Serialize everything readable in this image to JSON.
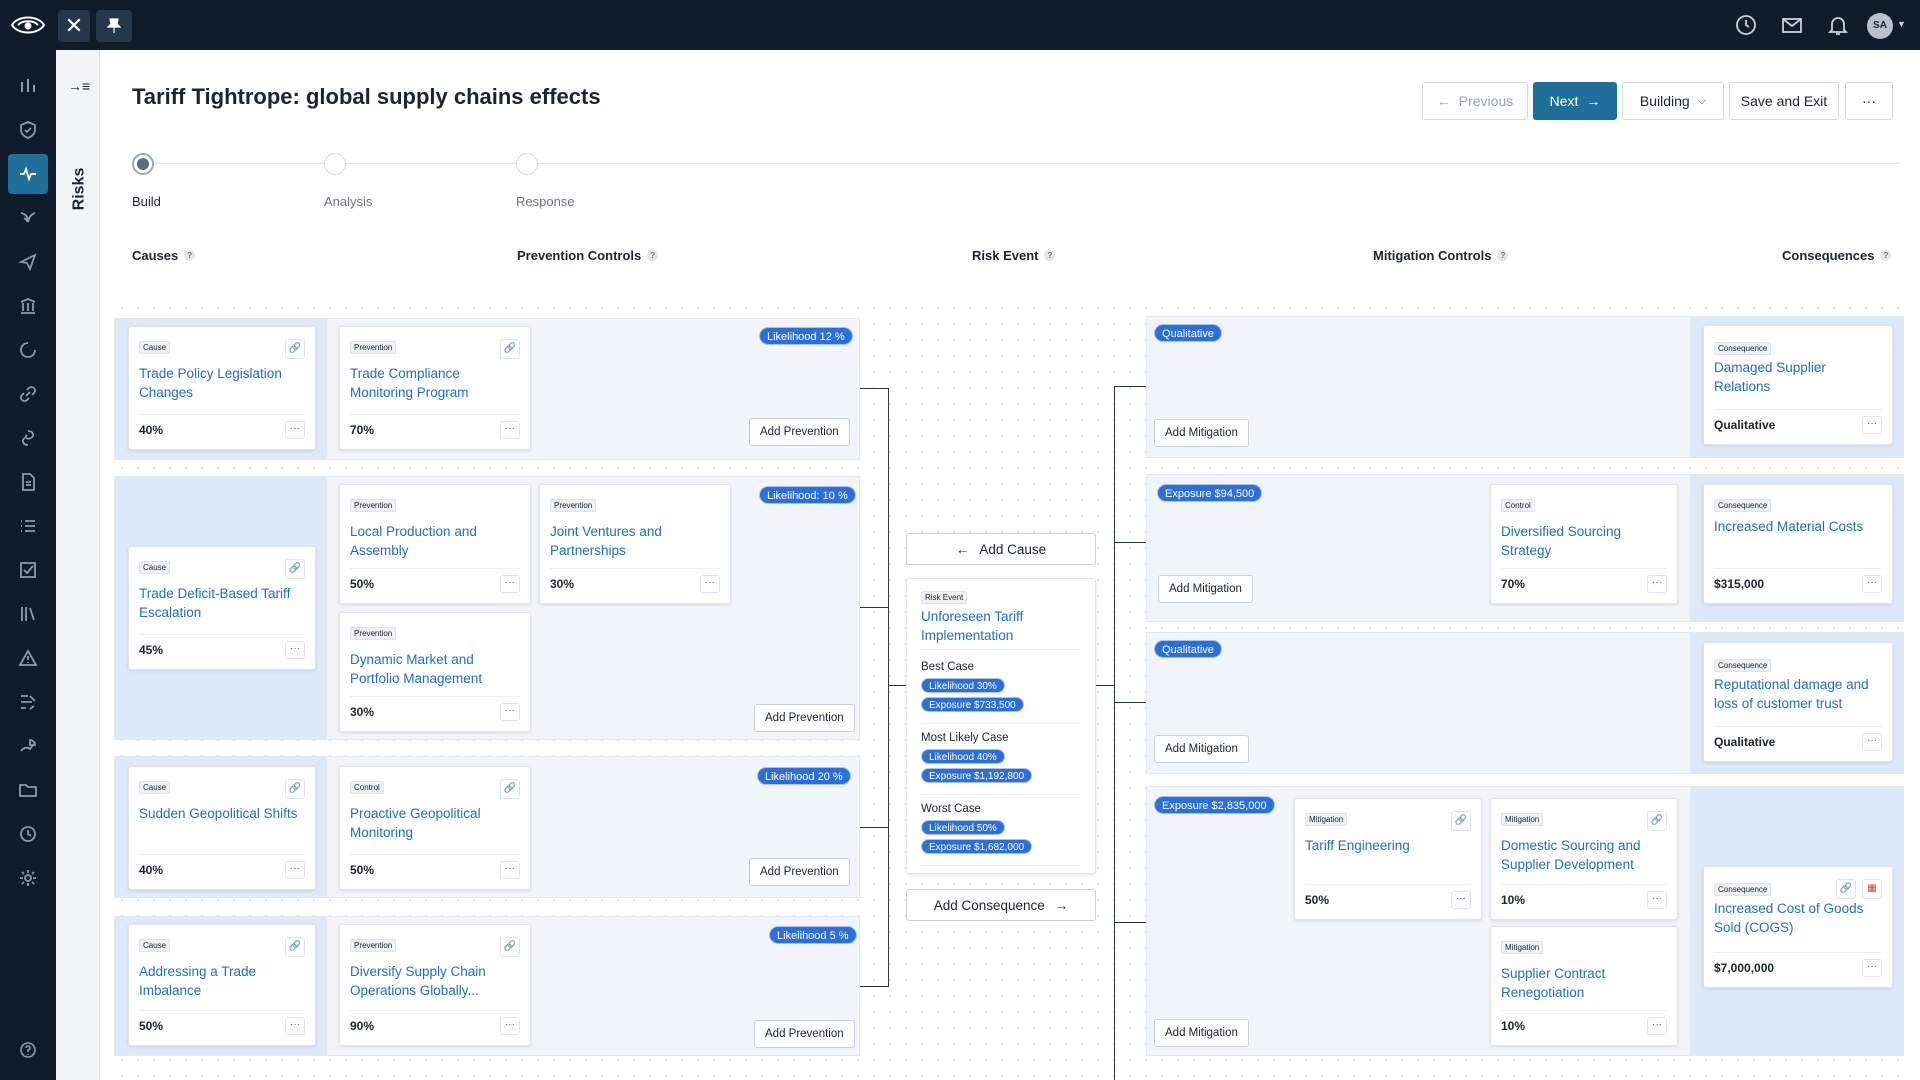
{
  "topbar": {
    "close_glyph": "✕",
    "pin_glyph": "📌",
    "avatar": "SA",
    "icons": [
      "clock-icon",
      "mail-icon",
      "bell-icon"
    ]
  },
  "nav": {
    "icons": [
      "bar-chart-icon",
      "shield-icon",
      "activity-icon",
      "bird-icon",
      "send-icon",
      "building-icon",
      "circle-notch-icon",
      "link-icon",
      "swirl-icon",
      "document-icon",
      "list-icon",
      "checkbox-icon",
      "library-icon",
      "warning-icon",
      "flow-icon",
      "chart-hand-icon",
      "folder-icon",
      "history-icon",
      "gear-icon",
      "help-icon"
    ],
    "active": 2
  },
  "risks_panel": {
    "label": "Risks",
    "expand_glyph": "→≡"
  },
  "header": {
    "title": "Tariff Tightrope: global supply chains effects",
    "previous": "Previous",
    "next": "Next",
    "status": "Building",
    "save_exit": "Save and Exit",
    "more": "···"
  },
  "stepper": {
    "steps": [
      {
        "label": "Build",
        "active": true
      },
      {
        "label": "Analysis",
        "active": false
      },
      {
        "label": "Response",
        "active": false
      }
    ]
  },
  "columns": {
    "causes": "Causes",
    "prevention": "Prevention Controls",
    "risk_event": "Risk Event",
    "mitigation": "Mitigation Controls",
    "consequences": "Consequences",
    "help": "?"
  },
  "causes": [
    {
      "tag": "Cause",
      "title": "Trade Policy Legislation Changes",
      "value": "40%"
    },
    {
      "tag": "Cause",
      "title": "Trade Deficit-Based Tariff Escalation",
      "value": "45%"
    },
    {
      "tag": "Cause",
      "title": "Sudden Geopolitical Shifts",
      "value": "40%"
    },
    {
      "tag": "Cause",
      "title": "Addressing a Trade Imbalance",
      "value": "50%"
    }
  ],
  "preventions": [
    {
      "tag": "Prevention",
      "title": "Trade Compliance Monitoring Program",
      "value": "70%"
    },
    {
      "tag": "Prevention",
      "title": "Local Production and Assembly",
      "value": "50%"
    },
    {
      "tag": "Prevention",
      "title": "Joint Ventures and Partnerships",
      "value": "30%"
    },
    {
      "tag": "Prevention",
      "title": "Dynamic Market and Portfolio Management",
      "value": "30%"
    },
    {
      "tag": "Control",
      "title": "Proactive Geopolitical Monitoring",
      "value": "50%"
    },
    {
      "tag": "Prevention",
      "title": "Diversify Supply Chain Operations Globally...",
      "value": "90%"
    }
  ],
  "likelihood_pills": [
    "Likelihood 12 %",
    "Likelihood: 10 %",
    "Likelihood 20 %",
    "Likelihood 5 %"
  ],
  "add_prevention": "Add Prevention",
  "risk_event": {
    "add_cause": "Add Cause",
    "add_consequence": "Add Consequence",
    "tag": "Risk Event",
    "title": "Unforeseen Tariff Implementation",
    "scenarios": [
      {
        "name": "Best Case",
        "likelihood": "Likelihood 30%",
        "exposure": "Exposure $733,500"
      },
      {
        "name": "Most Likely Case",
        "likelihood": "Likelihood 40%",
        "exposure": "Exposure $1,192,800"
      },
      {
        "name": "Worst Case",
        "likelihood": "Likelihood 50%",
        "exposure": "Exposure $1,682,000"
      }
    ]
  },
  "mitigation_pills": [
    "Qualitative",
    "Exposure $94,500",
    "Qualitative",
    "Exposure $2,835,000"
  ],
  "add_mitigation": "Add Mitigation",
  "mitigations": [
    {
      "tag": "Control",
      "title": "Diversified Sourcing Strategy",
      "value": "70%"
    },
    {
      "tag": "Mitigation",
      "title": "Tariff Engineering",
      "value": "50%"
    },
    {
      "tag": "Mitigation",
      "title": "Domestic Sourcing and Supplier Development",
      "value": "10%"
    },
    {
      "tag": "Mitigation",
      "title": "Supplier Contract Renegotiation",
      "value": "10%"
    }
  ],
  "consequences": [
    {
      "tag": "Consequence",
      "title": "Damaged Supplier Relations",
      "value": "Qualitative"
    },
    {
      "tag": "Consequence",
      "title": "Increased Material Costs",
      "value": "$315,000"
    },
    {
      "tag": "Consequence",
      "title": "Reputational damage and loss of customer trust",
      "value": "Qualitative"
    },
    {
      "tag": "Consequence",
      "title": "Increased Cost of Goods Sold (COGS)",
      "value": "$7,000,000"
    }
  ],
  "colors": {
    "nav_bg": "#101c2c",
    "primary": "#1f6f9a",
    "link": "#1f6fc2",
    "pill": "#2d6fd8",
    "row_bg": "#f1f4f8",
    "cause_bg": "#dde9f8"
  }
}
